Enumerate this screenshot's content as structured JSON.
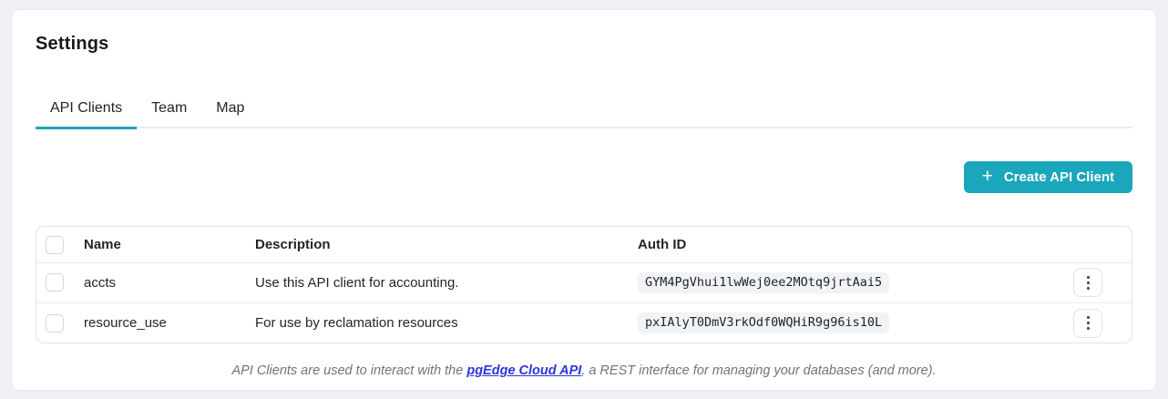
{
  "page": {
    "title": "Settings"
  },
  "tabs": [
    {
      "label": "API Clients",
      "active": true
    },
    {
      "label": "Team",
      "active": false
    },
    {
      "label": "Map",
      "active": false
    }
  ],
  "toolbar": {
    "create_button_label": "Create API Client",
    "create_button_icon": "+"
  },
  "table": {
    "columns": {
      "name": "Name",
      "description": "Description",
      "auth_id": "Auth ID"
    },
    "rows": [
      {
        "name": "accts",
        "description": "Use this API client for accounting.",
        "auth_id": "GYM4PgVhui1lwWej0ee2MOtq9jrtAai5"
      },
      {
        "name": "resource_use",
        "description": "For use by reclamation resources",
        "auth_id": "pxIAlyT0DmV3rkOdf0WQHiR9g96is10L"
      }
    ]
  },
  "footer": {
    "text_before": "API Clients are used to interact with the ",
    "link_label": "pgEdge Cloud API",
    "text_after": ", a REST interface for managing your databases (and more)."
  },
  "colors": {
    "accent_teal": "#1aa6bb",
    "link_blue": "#2b36d9",
    "badge_bg": "#f1f3f5",
    "border": "#dee2e6"
  }
}
